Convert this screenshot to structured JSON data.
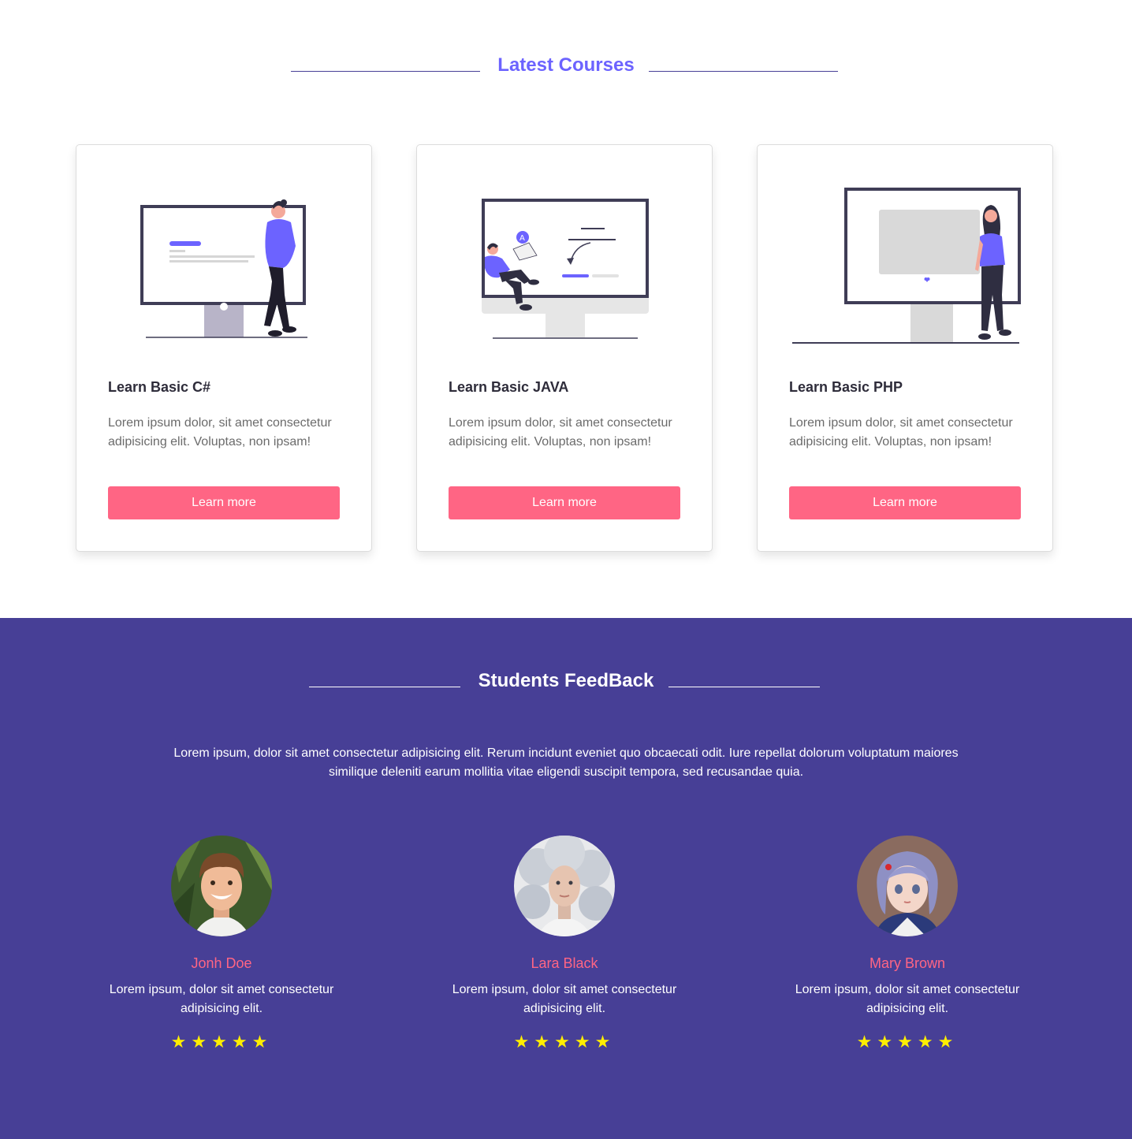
{
  "colors": {
    "primary": "#473f96",
    "accent_heading": "#6c63ff",
    "button": "#ff6584",
    "student_name": "#ff6584",
    "star": "#ffee00"
  },
  "courses_section": {
    "title": "Latest Courses",
    "cards": [
      {
        "title": "Learn Basic C#",
        "description": "Lorem ipsum dolor, sit amet consectetur adipisicing elit. Voluptas, non ipsam!",
        "button_label": "Learn more"
      },
      {
        "title": "Learn Basic JAVA",
        "description": "Lorem ipsum dolor, sit amet consectetur adipisicing elit. Voluptas, non ipsam!",
        "button_label": "Learn more"
      },
      {
        "title": "Learn Basic PHP",
        "description": "Lorem ipsum dolor, sit amet consectetur adipisicing elit. Voluptas, non ipsam!",
        "button_label": "Learn more"
      }
    ]
  },
  "feedback_section": {
    "title": "Students FeedBack",
    "intro": "Lorem ipsum, dolor sit amet consectetur adipisicing elit. Rerum incidunt eveniet quo obcaecati odit. Iure repellat dolorum voluptatum maiores similique deleniti earum mollitia vitae eligendi suscipit tempora, sed recusandae quia.",
    "students": [
      {
        "name": "Jonh Doe",
        "text": "Lorem ipsum, dolor sit amet consectetur adipisicing elit.",
        "rating": 5
      },
      {
        "name": "Lara Black",
        "text": "Lorem ipsum, dolor sit amet consectetur adipisicing elit.",
        "rating": 5
      },
      {
        "name": "Mary Brown",
        "text": "Lorem ipsum, dolor sit amet consectetur adipisicing elit.",
        "rating": 5
      }
    ]
  }
}
